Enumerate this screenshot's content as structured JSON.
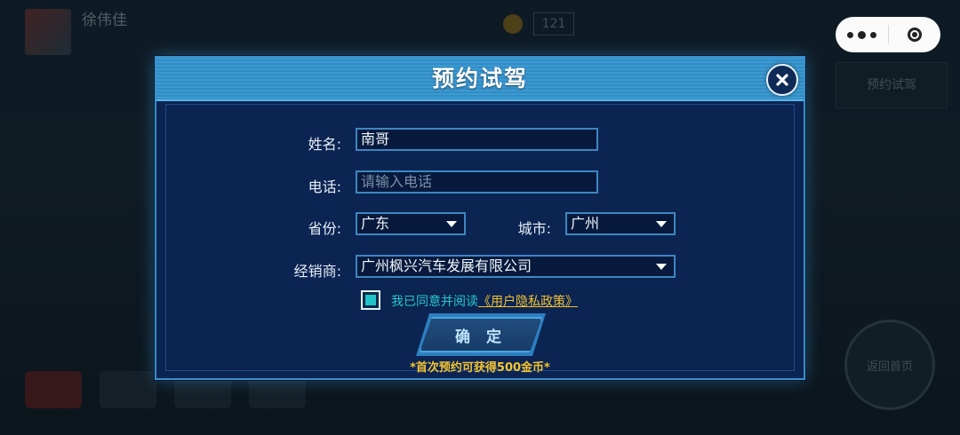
{
  "background": {
    "title": "徐伟佳",
    "coin_value": "121",
    "right_button": "预约试驾",
    "circle_button": "返回首页"
  },
  "capsule": {
    "more_icon": "more-dots-icon",
    "close_icon": "target-close-icon"
  },
  "modal": {
    "title": "预约试驾",
    "close_icon": "close-x-icon",
    "name": {
      "label": "姓名:",
      "value": "南哥"
    },
    "phone": {
      "label": "电话:",
      "placeholder": "请输入电话",
      "value": ""
    },
    "province": {
      "label": "省份:",
      "value": "广东"
    },
    "city": {
      "label": "城市:",
      "value": "广州"
    },
    "dealer": {
      "label": "经销商:",
      "value": "广州枫兴汽车发展有限公司"
    },
    "agreement": {
      "checked": true,
      "text": "我已同意并阅读",
      "link": "《用户隐私政策》"
    },
    "confirm_label": "确 定",
    "bonus_note": "*首次预约可获得500金币*"
  },
  "colors": {
    "accent": "#3c9ad2",
    "link": "#f0c030",
    "agree_text": "#27c7cb",
    "modal_bg": "#0b2452"
  }
}
